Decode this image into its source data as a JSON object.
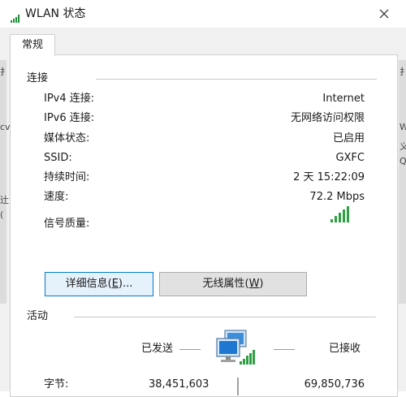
{
  "window": {
    "title": "WLAN 状态",
    "title_icon": "wifi-signal-icon",
    "close_icon": "close-icon"
  },
  "tabs": [
    {
      "label": "常规",
      "selected": true
    }
  ],
  "connection": {
    "section_label": "连接",
    "rows": [
      {
        "label": "IPv4 连接:",
        "value": "Internet"
      },
      {
        "label": "IPv6 连接:",
        "value": "无网络访问权限"
      },
      {
        "label": "媒体状态:",
        "value": "已启用"
      },
      {
        "label": "SSID:",
        "value": "GXFC"
      },
      {
        "label": "持续时间:",
        "value": "2 天 15:22:09"
      },
      {
        "label": "速度:",
        "value": "72.2 Mbps"
      }
    ],
    "signal_quality_label": "信号质量:",
    "signal_bars": 5,
    "signal_icon": "signal-bars-icon"
  },
  "buttons": {
    "details": {
      "text": "详细信息(",
      "mnemonic": "E",
      "suffix": ")..."
    },
    "wireless": {
      "text": "无线属性(",
      "mnemonic": "W",
      "suffix": ")"
    }
  },
  "activity": {
    "section_label": "活动",
    "sent_label": "已发送",
    "received_label": "已接收",
    "bytes_label": "字节:",
    "bytes_sent": "38,451,603",
    "bytes_received": "69,850,736",
    "icon": "network-computers-icon"
  },
  "background_fragments": [
    "扌",
    "扌",
    "cv",
    "W",
    "义",
    "Q",
    "辻",
    "("
  ],
  "colors": {
    "accent": "#0078d7",
    "signal": "#2ea043",
    "panel_border": "#cfcfcf"
  }
}
